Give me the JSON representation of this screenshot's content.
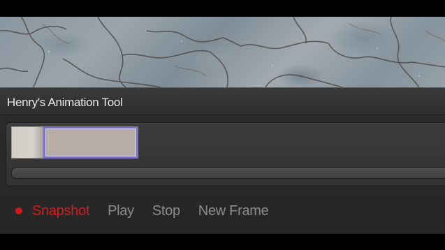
{
  "window": {
    "title": "Henry's Animation Tool"
  },
  "viewport": {
    "description_icon": "camera-feed-image"
  },
  "timeline": {
    "frames": [
      {
        "label": "",
        "selected": false
      },
      {
        "label": "",
        "selected": true
      }
    ]
  },
  "controls": {
    "record_indicator": "recording-dot-icon",
    "snapshot_label": "Snapshot",
    "play_label": "Play",
    "stop_label": "Stop",
    "new_frame_label": "New Frame"
  },
  "colors": {
    "accent_red": "#d41c1c",
    "selection_border": "#7c75c9",
    "inactive_text": "#8c8c8c"
  }
}
